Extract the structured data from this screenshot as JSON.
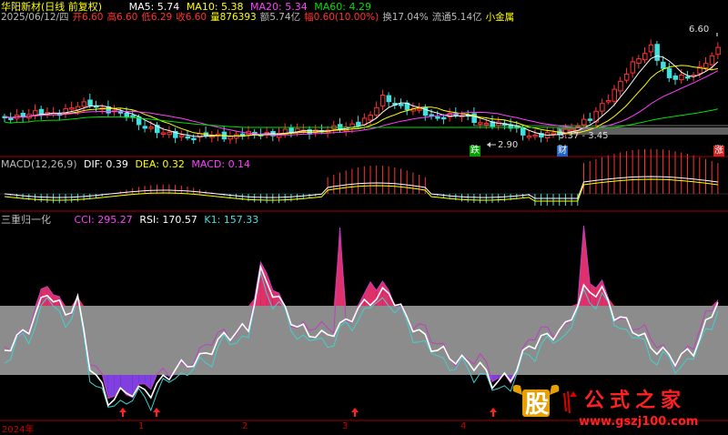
{
  "header": {
    "stock_name": "华阳新材(日线 前复权)",
    "ma5": "MA5: 5.74",
    "ma10": "MA10: 5.38",
    "ma20": "MA20: 5.34",
    "ma60": "MA60: 4.29"
  },
  "quote": {
    "date": "2025/06/12/四",
    "open": "开6.60",
    "high": "高6.60",
    "low": "低6.29",
    "close": "收6.60",
    "volume": "量876393",
    "amount": "额5.74亿",
    "change": "幅0.60(10.00%)",
    "turnover": "换17.04%",
    "float": "流通5.14亿",
    "tag": "小金属"
  },
  "price_panel": {
    "high_label": "6.60",
    "low_label": "2.90",
    "range_label": "3.37 - 3.45",
    "badge_down": "跌",
    "badge_cai": "财",
    "badge_up": "涨"
  },
  "macd_panel": {
    "title": "MACD(12,26,9)",
    "dif": "DIF: 0.39",
    "dea": "DEA: 0.32",
    "macd": "MACD: 0.14"
  },
  "indicator_panel": {
    "title": "三重归一化",
    "cci": "CCI: 295.27",
    "rsi": "RSI: 170.57",
    "k1": "K1: 157.33"
  },
  "time_axis": {
    "year": "2024年",
    "months": [
      "1",
      "2",
      "3",
      "4"
    ]
  },
  "watermark": {
    "logo_char": "股",
    "brand": "公式之家",
    "url": "www.gszj100.com"
  },
  "colors": {
    "up": "#ff3232",
    "down": "#40e0e0",
    "ma5": "#ffffff",
    "ma10": "#ffff00",
    "ma20": "#ff40ff",
    "ma60": "#00e000"
  }
}
